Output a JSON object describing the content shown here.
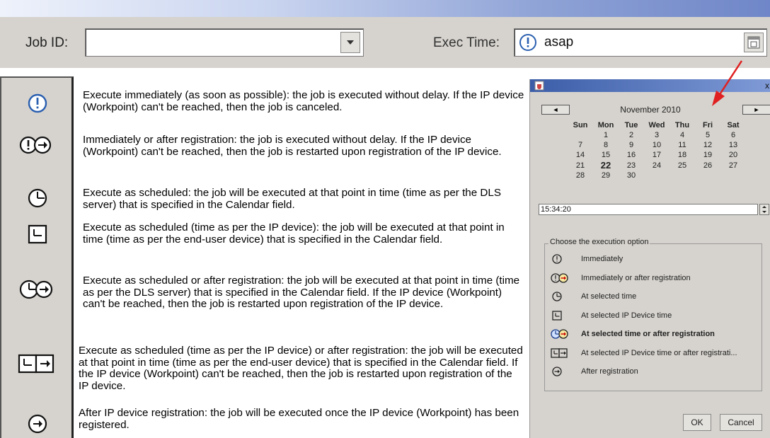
{
  "toolbar": {
    "job_id_label": "Job ID:",
    "job_id_value": "",
    "exec_time_label": "Exec Time:",
    "exec_time_value": "asap"
  },
  "descriptions": [
    {
      "icon": "immediately-icon",
      "text": "Execute immediately (as soon as possible): the job is executed without delay. If the IP device (Workpoint) can't be reached, then the job is canceled."
    },
    {
      "icon": "immediately-or-after-registration-icon",
      "text": "Immediately or after registration: the job is executed without delay. If the IP device (Workpoint) can't be reached, then the job is restarted upon registration of the IP device."
    },
    {
      "icon": "clock-icon",
      "text": "Execute as scheduled: the job will be executed at that point in time (time as per the DLS server) that is specified in the Calendar field."
    },
    {
      "icon": "ip-device-time-icon",
      "text": "Execute as scheduled (time as per the IP device): the job will be executed at that point in time (time as per the end-user device) that is specified in the Calendar field."
    },
    {
      "icon": "clock-or-after-registration-icon",
      "text": "Execute as scheduled or after registration: the job will be executed at that point in time (time as per the DLS server) that is specified in the Calendar field. If the IP device (Workpoint) can't be reached, then the job is restarted upon registration of the IP device."
    },
    {
      "icon": "ip-device-time-or-after-registration-icon",
      "text": "Execute as scheduled (time as per the IP device) or after registration: the job will be executed at that point in time (time as per the end-user device) that is specified in the Calendar field. If the IP device (Workpoint) can't be reached, then the job is restarted upon registration of the IP device."
    },
    {
      "icon": "after-registration-icon",
      "text": "After IP device registration: the job will be executed once the IP device (Workpoint) has been registered."
    }
  ],
  "dialog": {
    "prev_label": "◄",
    "next_label": "►",
    "close_label": "x",
    "month": "November 2010",
    "weekdays": [
      "Sun",
      "Mon",
      "Tue",
      "Wed",
      "Thu",
      "Fri",
      "Sat"
    ],
    "weeks": [
      [
        "",
        "1",
        "2",
        "3",
        "4",
        "5",
        "6"
      ],
      [
        "7",
        "8",
        "9",
        "10",
        "11",
        "12",
        "13"
      ],
      [
        "14",
        "15",
        "16",
        "17",
        "18",
        "19",
        "20"
      ],
      [
        "21",
        "22",
        "23",
        "24",
        "25",
        "26",
        "27"
      ],
      [
        "28",
        "29",
        "30",
        "",
        "",
        "",
        ""
      ]
    ],
    "today": "22",
    "time": "15:34:20",
    "options_legend": "Choose the execution option",
    "options": [
      {
        "icon": "immediately-icon",
        "label": "Immediately",
        "selected": false
      },
      {
        "icon": "immediately-or-after-registration-icon",
        "label": "Immediately or after registration",
        "selected": false
      },
      {
        "icon": "clock-icon",
        "label": "At selected time",
        "selected": false
      },
      {
        "icon": "ip-device-time-icon",
        "label": "At selected IP Device time",
        "selected": false
      },
      {
        "icon": "clock-or-after-registration-icon",
        "label": "At selected time or after registration",
        "selected": true
      },
      {
        "icon": "ip-device-time-or-after-registration-icon",
        "label": "At selected IP Device time or after registrati...",
        "selected": false
      },
      {
        "icon": "after-registration-icon",
        "label": "After registration",
        "selected": false
      }
    ],
    "ok_label": "OK",
    "cancel_label": "Cancel"
  },
  "colors": {
    "accent": "#2a5fb0",
    "arrow": "#e02020",
    "panel": "#d6d3ce"
  }
}
